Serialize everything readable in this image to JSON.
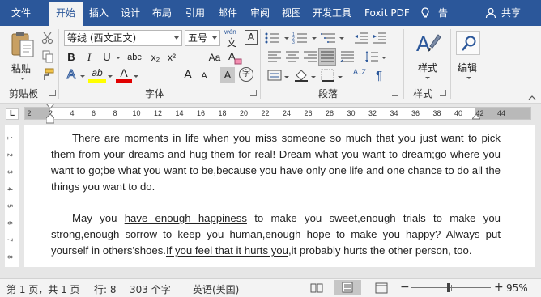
{
  "tabs": [
    "文件",
    "开始",
    "插入",
    "设计",
    "布局",
    "引用",
    "邮件",
    "审阅",
    "视图",
    "开发工具",
    "Foxit PDF"
  ],
  "active_tab": "开始",
  "tell_me": "告诉我",
  "share": "共享",
  "groups": {
    "clipboard": "剪贴板",
    "font": "字体",
    "paragraph": "段落",
    "styles": "样式"
  },
  "clipboard": {
    "paste_label": "粘贴"
  },
  "font": {
    "family": "等线 (西文正文)",
    "size": "五号",
    "wen": "wén",
    "wen_char": "文",
    "grow": "A",
    "shrink": "A",
    "case": "Aa",
    "clear": "A",
    "border_char": "A",
    "bold": "B",
    "italic": "I",
    "underline": "U",
    "strike": "abc",
    "subscript": "x₂",
    "superscript": "x²",
    "effects": "A",
    "highlight": "ab",
    "font_color": "A",
    "shading": "A",
    "enclose": "字",
    "accent_color": "#2b579a",
    "highlight_color": "#ffff00",
    "font_color_bar": "#e00000"
  },
  "paragraph": {
    "sort": "A↓Z",
    "marks": "¶"
  },
  "styles_label": "样式",
  "edit_label": "编辑",
  "ruler": {
    "numbers": [
      "2",
      "2",
      "4",
      "6",
      "8",
      "10",
      "12",
      "14",
      "16",
      "18",
      "20",
      "22",
      "24",
      "26",
      "28",
      "30",
      "32",
      "34",
      "36",
      "38",
      "40",
      "42",
      "44"
    ],
    "vertical_numbers": [
      "1",
      "2",
      "3",
      "4",
      "5",
      "6",
      "7",
      "8"
    ],
    "tab_stop": "L"
  },
  "document": {
    "p1": [
      {
        "t": "There are moments in life when you miss someone so much that you just want to pick them from your dreams and hug them for real! Dream what you want to dream;go where you want to go;",
        "u": false
      },
      {
        "t": "be what you want to be",
        "u": true
      },
      {
        "t": ",because you have only one life and one chance to do all the things you want to do.",
        "u": false
      }
    ],
    "p2": [
      {
        "t": "May you ",
        "u": false
      },
      {
        "t": "have enough happiness",
        "u": true
      },
      {
        "t": " to make you sweet,enough trials to make you strong,enough sorrow to keep you human,enough hope to make you happy? Always put yourself in others’shoes.",
        "u": false
      },
      {
        "t": "If you feel that it hurts you",
        "u": true
      },
      {
        "t": ",it probably hurts the other person, too.",
        "u": false
      }
    ]
  },
  "status": {
    "page": "第 1 页，共 1 页",
    "line": "行: 8",
    "words": "303 个字",
    "language": "英语(美国)",
    "zoom": "95%",
    "zoom_level": 0.95,
    "minus": "−",
    "plus": "+"
  }
}
